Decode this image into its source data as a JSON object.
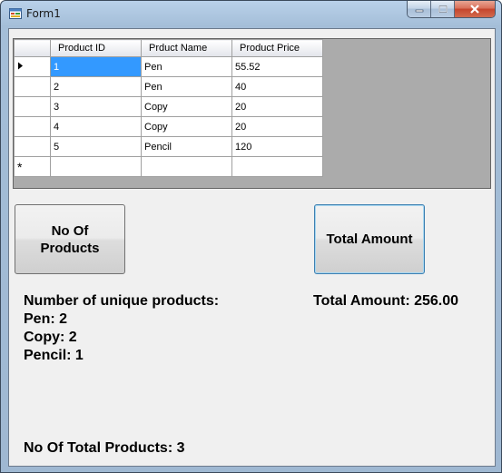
{
  "window": {
    "title": "Form1"
  },
  "grid": {
    "columns": [
      "Product ID",
      "Prduct Name",
      "Product Price"
    ],
    "rows": [
      [
        "1",
        "Pen",
        "55.52"
      ],
      [
        "2",
        "Pen",
        "40"
      ],
      [
        "3",
        "Copy",
        "20"
      ],
      [
        "4",
        "Copy",
        "20"
      ],
      [
        "5",
        "Pencil",
        "120"
      ]
    ],
    "new_row_marker": "*"
  },
  "buttons": {
    "no_of_products": "No Of Products",
    "total_amount": "Total Amount"
  },
  "results": {
    "unique_heading": "Number of unique products:",
    "unique_lines": [
      "Pen: 2",
      "Copy: 2",
      "Pencil: 1"
    ],
    "total_amount": "Total Amount: 256.00",
    "total_products": "No Of Total Products: 3"
  }
}
